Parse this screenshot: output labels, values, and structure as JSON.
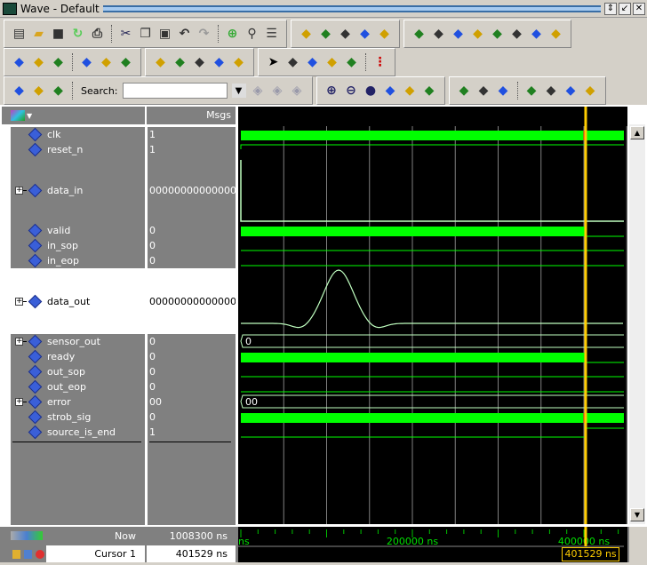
{
  "window": {
    "title": "Wave - Default"
  },
  "toolbar": {
    "rows": [
      [
        [
          "new-file-icon",
          "open-folder-icon",
          "save-icon",
          "reload-icon",
          "print-icon",
          "|",
          "cut-icon",
          "copy-icon",
          "paste-icon",
          "undo-icon",
          "redo-icon",
          "|",
          "add-icon",
          "find-icon",
          "expand-list-icon"
        ],
        [
          "add-wave-icon",
          "help-icon",
          "dataflow-icon",
          "printer-setup-icon",
          "delete-icon"
        ],
        [
          "insert-cursor-icon",
          "delete-cursor-icon",
          "prev-edge-icon",
          "next-edge-icon",
          "prev-fall-icon",
          "next-fall-icon",
          "prev-rise-icon",
          "next-rise-icon"
        ]
      ],
      [
        [
          "step-icon",
          "step-over-icon",
          "step-out-icon",
          "|",
          "step-all-icon",
          "step-over-all-icon",
          "step-out-all-icon"
        ],
        [
          "restart-icon",
          "break-icon",
          "continue-icon",
          "run-icon",
          "run-all-icon"
        ],
        [
          "select-mode-icon",
          "zoom-mode-icon",
          "pan-mode-icon",
          "measure-mode-icon",
          "edit-mode-icon",
          "|",
          "stop-light-icon"
        ]
      ],
      [
        [
          "contributors-icon",
          "readers-icon",
          "dataflow-trace-icon",
          "|"
        ],
        [
          "zoom-in-icon",
          "zoom-out-icon",
          "zoom-full-icon",
          "zoom-cursor-icon",
          "zoom-between-cursors-icon",
          "zoom-region-icon"
        ],
        [
          "wave-line-icon",
          "wave-bar-icon",
          "wave-block-icon",
          "|",
          "wave-dense-icon",
          "wave-step-icon",
          "wave-dashed-icon",
          "wave-edge-icon"
        ]
      ]
    ],
    "search_label": "Search:",
    "search_value": "",
    "search_placeholder": ""
  },
  "header": {
    "msgs_label": "Msgs"
  },
  "signals": [
    {
      "name": "clk",
      "value": "1",
      "wave": "high-solid",
      "expandable": false
    },
    {
      "name": "reset_n",
      "value": "1",
      "wave": "high-line",
      "expandable": false
    },
    {
      "name": "data_in",
      "value": "00000000000000...",
      "wave": "analog-step",
      "expandable": true,
      "format": "analog"
    },
    {
      "name": "valid",
      "value": "0",
      "wave": "solid-until-cursor",
      "expandable": false
    },
    {
      "name": "in_sop",
      "value": "0",
      "wave": "low",
      "expandable": false
    },
    {
      "name": "in_eop",
      "value": "0",
      "wave": "low",
      "expandable": false
    },
    {
      "name": "data_out",
      "value": "00000000000000...",
      "wave": "analog-pulse",
      "expandable": true,
      "format": "analog",
      "selected": true
    },
    {
      "name": "sensor_out",
      "value": "0",
      "wave": "bus",
      "bus_text": "0",
      "expandable": true
    },
    {
      "name": "ready",
      "value": "0",
      "wave": "solid-until-cursor",
      "expandable": false
    },
    {
      "name": "out_sop",
      "value": "0",
      "wave": "low",
      "expandable": false
    },
    {
      "name": "out_eop",
      "value": "0",
      "wave": "low",
      "expandable": false
    },
    {
      "name": "error",
      "value": "00",
      "wave": "bus",
      "bus_text": "00",
      "expandable": true
    },
    {
      "name": "strob_sig",
      "value": "0",
      "wave": "high-solid",
      "expandable": false
    },
    {
      "name": "source_is_end",
      "value": "1",
      "wave": "low-then-high",
      "expandable": false
    }
  ],
  "footer": {
    "now_label": "Now",
    "now_value": "1008300 ns",
    "cursor_label": "Cursor 1",
    "cursor_value": "401529 ns",
    "cursor_flag": "401529 ns"
  },
  "time_axis": {
    "unit": "ns",
    "labels": [
      {
        "t": 0,
        "text": "ns"
      },
      {
        "t": 200000,
        "text": "200000 ns"
      },
      {
        "t": 400000,
        "text": "400000 ns"
      }
    ],
    "range_ns": [
      0,
      450000
    ],
    "grid_step_ns": 50000,
    "cursor_ns": 401529
  },
  "colors": {
    "wave": "#00ff00",
    "analog": "#c0ffc0",
    "cursor": "#ffcc00",
    "grid": "#808080",
    "background": "#000000"
  }
}
